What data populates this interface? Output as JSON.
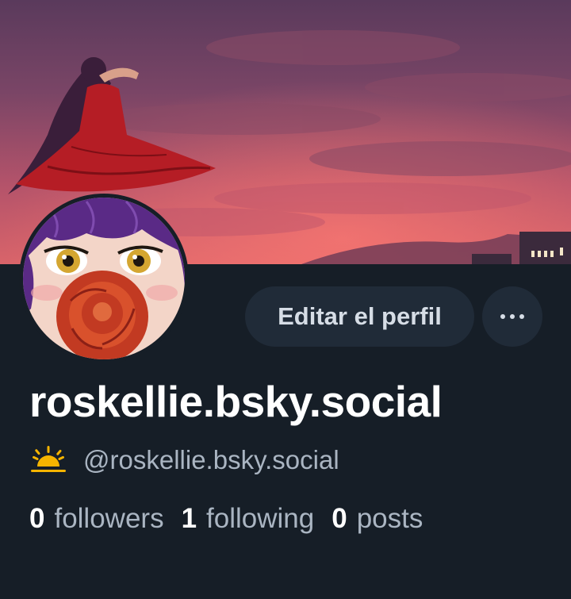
{
  "profile": {
    "display_name": "roskellie.bsky.social",
    "handle": "@roskellie.bsky.social",
    "handle_icon": "sun-icon",
    "edit_button_label": "Editar el perfil",
    "more_button_label": "···",
    "avatar_icon": "avatar-image",
    "banner_icon": "banner-image"
  },
  "stats": {
    "followers": {
      "count": "0",
      "label": "followers"
    },
    "following": {
      "count": "1",
      "label": "following"
    },
    "posts": {
      "count": "0",
      "label": "posts"
    }
  },
  "colors": {
    "background": "#161e27",
    "button_bg": "#202b38",
    "text_primary": "#ffffff",
    "text_secondary": "#aab5c2",
    "sun_icon": "#f5b400"
  }
}
